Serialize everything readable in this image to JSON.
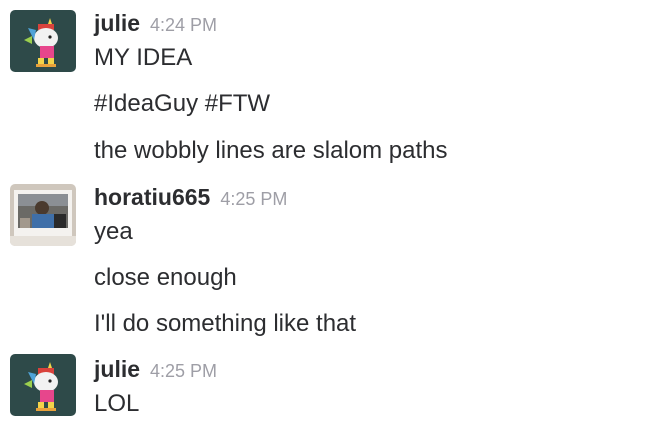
{
  "messages": [
    {
      "author": "julie",
      "time": "4:24 PM",
      "avatar_icon": "unicorn-avatar-icon",
      "lines": [
        "MY IDEA",
        "#IdeaGuy #FTW",
        "the wobbly lines are slalom paths"
      ]
    },
    {
      "author": "horatiu665",
      "time": "4:25 PM",
      "avatar_icon": "photo-avatar-icon",
      "lines": [
        "yea",
        "close enough",
        "I'll do something like that"
      ]
    },
    {
      "author": "julie",
      "time": "4:25 PM",
      "avatar_icon": "unicorn-avatar-icon",
      "lines": [
        "LOL"
      ]
    }
  ],
  "colors": {
    "text": "#2c2d30",
    "timestamp": "#9e9ea6",
    "avatar_bg": "#2e4a49"
  }
}
